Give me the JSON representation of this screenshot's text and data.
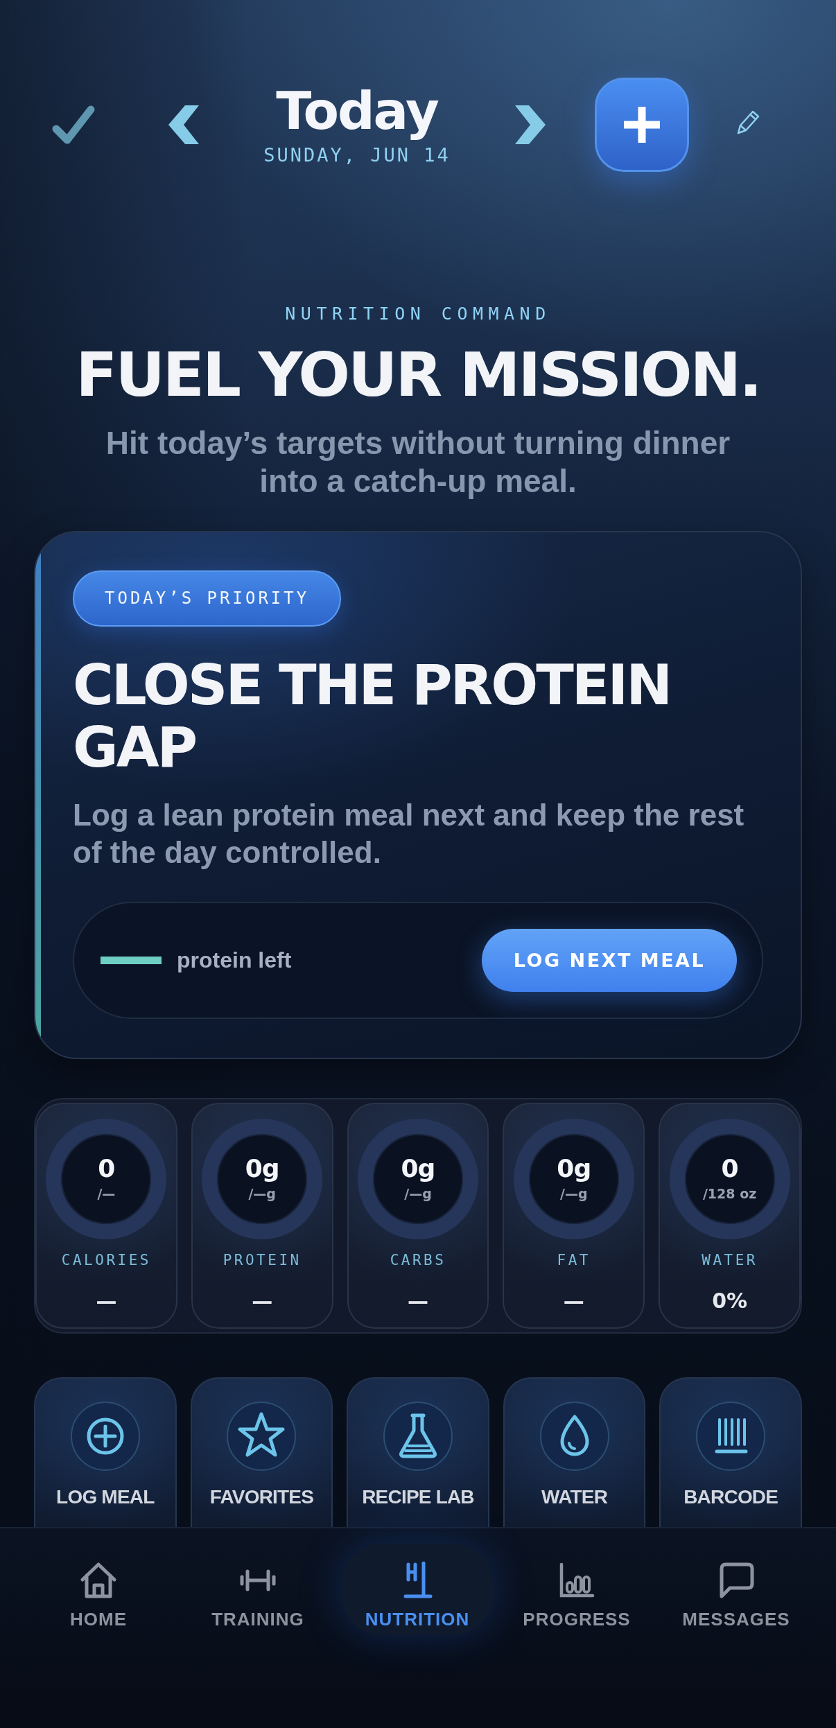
{
  "header": {
    "title": "Today",
    "date": "SUNDAY, JUN 14"
  },
  "intro": {
    "eyebrow": "NUTRITION COMMAND",
    "title": "FUEL YOUR MISSION.",
    "subtitle": "Hit today’s targets without turning dinner into a catch-up meal."
  },
  "priority_card": {
    "badge": "TODAY’S PRIORITY",
    "title": "CLOSE THE PROTEIN GAP",
    "description": "Log a lean protein meal next and keep the rest of the day controlled.",
    "progress_label": "protein left",
    "button": "LOG NEXT MEAL"
  },
  "macros": [
    {
      "label": "CALORIES",
      "value": "0",
      "target": "/—",
      "status": "—"
    },
    {
      "label": "PROTEIN",
      "value": "0g",
      "target": "/—g",
      "status": "—"
    },
    {
      "label": "CARBS",
      "value": "0g",
      "target": "/—g",
      "status": "—"
    },
    {
      "label": "FAT",
      "value": "0g",
      "target": "/—g",
      "status": "—"
    },
    {
      "label": "WATER",
      "value": "0",
      "target": "/128 oz",
      "status": "0%"
    }
  ],
  "quick_actions": [
    {
      "label": "LOG MEAL"
    },
    {
      "label": "FAVORITES"
    },
    {
      "label": "RECIPE LAB"
    },
    {
      "label": "WATER"
    },
    {
      "label": "BARCODE"
    }
  ],
  "nav": [
    {
      "label": "HOME",
      "selected": false
    },
    {
      "label": "TRAINING",
      "selected": false
    },
    {
      "label": "NUTRITION",
      "selected": true
    },
    {
      "label": "PROGRESS",
      "selected": false
    },
    {
      "label": "MESSAGES",
      "selected": false
    }
  ]
}
